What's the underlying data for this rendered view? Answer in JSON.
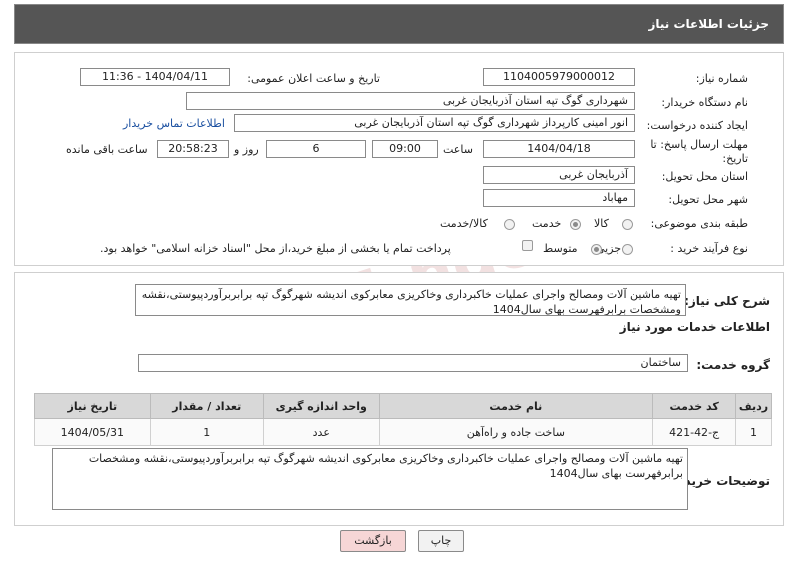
{
  "header": {
    "title": "جزئیات اطلاعات نیاز"
  },
  "form": {
    "need_number": {
      "label": "شماره نیاز:",
      "value": "1104005979000012"
    },
    "announce_datetime": {
      "label": "تاریخ و ساعت اعلان عمومی:",
      "value": "1404/04/11 - 11:36"
    },
    "buyer_org": {
      "label": "نام دستگاه خریدار:",
      "value": "شهرداری گوگ تپه استان آذربایجان غربی"
    },
    "requester": {
      "label": "ایجاد کننده درخواست:",
      "value": "انور امینی کارپرداز شهرداری گوگ تپه استان آذربایجان غربی",
      "contact_link": "اطلاعات تماس خریدار"
    },
    "deadline": {
      "label": "مهلت ارسال پاسخ: تا تاریخ:",
      "date": "1404/04/18",
      "time_label": "ساعت",
      "time": "09:00",
      "days": "6",
      "days_label": "روز و",
      "remaining": "20:58:23",
      "remaining_label": "ساعت باقی مانده"
    },
    "province": {
      "label": "استان محل تحویل:",
      "value": "آذربایجان غربی"
    },
    "city": {
      "label": "شهر محل تحویل:",
      "value": "مهاباد"
    },
    "category": {
      "label": "طبقه بندی موضوعی:",
      "options": [
        "کالا",
        "خدمت",
        "کالا/خدمت"
      ],
      "selected": "خدمت"
    },
    "process": {
      "label": "نوع فرآیند خرید :",
      "options": [
        "جزیی",
        "متوسط"
      ],
      "selected": "متوسط",
      "payment_note": "پرداخت تمام یا بخشی از مبلغ خرید،از محل \"اسناد خزانه اسلامی\" خواهد بود."
    }
  },
  "description": {
    "label": "شرح کلی نیاز:",
    "text": "تهیه ماشین آلات ومصالح واجرای عملیات خاکبرداری وخاکریزی معابرکوی اندیشه شهرگوگ تپه برابربرآوردپیوستی،نقشه ومشخصات برابرفهرست بهای سال1404"
  },
  "services": {
    "section_title": "اطلاعات خدمات مورد نیاز",
    "group_label": "گروه خدمت:",
    "group_value": "ساختمان",
    "columns": [
      "ردیف",
      "کد خدمت",
      "نام خدمت",
      "واحد اندازه گیری",
      "تعداد / مقدار",
      "تاریخ نیاز"
    ],
    "rows": [
      [
        "1",
        "ج-42-421",
        "ساخت جاده و راه‌آهن",
        "عدد",
        "1",
        "1404/05/31"
      ]
    ]
  },
  "buyer_notes": {
    "label": "توضیحات خریدار:",
    "text": "تهیه ماشین آلات ومصالح واجرای عملیات خاکبرداری وخاکریزی معابرکوی اندیشه شهرگوگ تپه برابربرآوردپیوستی،نقشه ومشخصات برابرفهرست بهای سال1404"
  },
  "buttons": {
    "print": "چاپ",
    "back": "بازگشت"
  },
  "watermark": "AriaTender.neT",
  "colors": {
    "header_bg": "#555555",
    "back_button_bg": "#f6d6d6",
    "link": "#1a4fa0"
  }
}
